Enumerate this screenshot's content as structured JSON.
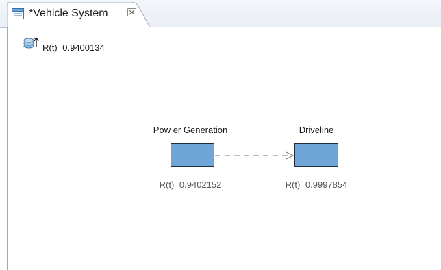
{
  "tab": {
    "title": "*Vehicle System",
    "icon": "diagram-editor-icon",
    "close_icon": "close-icon"
  },
  "system": {
    "icon": "reliability-stack-icon",
    "reliability": "R(t)=0.9400134"
  },
  "blocks": [
    {
      "name": "Pow er Generation",
      "reliability": "R(t)=0.9402152"
    },
    {
      "name": "Driveline",
      "reliability": "R(t)=0.9997854"
    }
  ],
  "connector": {
    "style": "dashed-arrow"
  },
  "colors": {
    "block_fill": "#6fa5d7",
    "block_border": "#1f2d3d",
    "tab_border": "#9aa9bd"
  }
}
